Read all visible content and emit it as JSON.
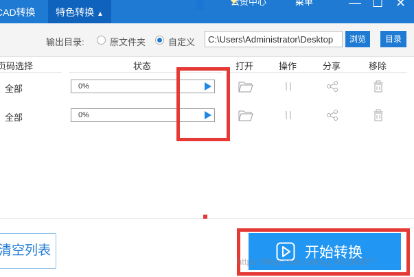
{
  "top_tabs": {
    "cad_convert": "CAD转换",
    "special_convert": "特色转换"
  },
  "top_bar": {
    "resource_center": "云资中心",
    "menu": "菜单"
  },
  "output": {
    "label": "输出目录:",
    "radio_original": "原文件夹",
    "radio_custom": "自定义",
    "selected": "custom",
    "path_value": "C:\\Users\\Administrator\\Desktop",
    "browse_label": "浏览",
    "directory_label": "目录"
  },
  "table": {
    "headers": {
      "page_select": "页码选择",
      "status": "状态",
      "open": "打开",
      "operation": "操作",
      "share": "分享",
      "remove": "移除"
    },
    "rows": [
      {
        "page": "全部",
        "progress": "0%"
      },
      {
        "page": "全部",
        "progress": "0%"
      }
    ]
  },
  "buttons": {
    "clear_list": "清空列表",
    "start_convert": "开始转换"
  },
  "watermark": "https://blog.csdn.net/qq_40239927",
  "colors": {
    "accent": "#1e7ad3",
    "start_button": "#2196f3",
    "highlight": "#e53935"
  }
}
